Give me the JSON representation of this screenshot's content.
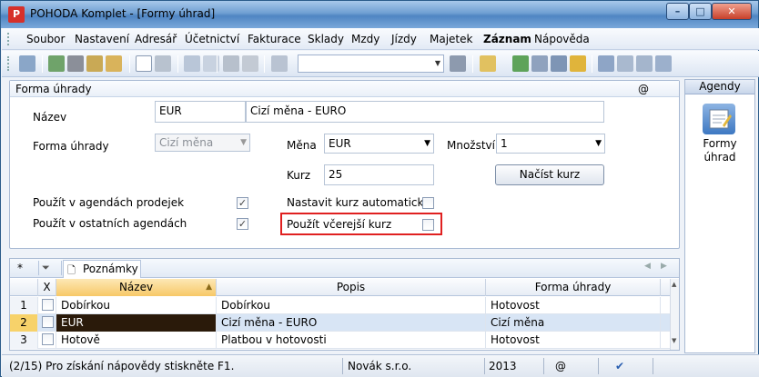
{
  "window": {
    "title": "POHODA Komplet - [Formy úhrad]"
  },
  "menu": [
    "Soubor",
    "Nastavení",
    "Adresář",
    "Účetnictví",
    "Fakturace",
    "Sklady",
    "Mzdy",
    "Jízdy",
    "Majetek",
    "Záznam",
    "Nápověda"
  ],
  "form": {
    "section_title": "Forma úhrady",
    "at_symbol": "@",
    "nazev_label": "Název",
    "nazev_code": "EUR",
    "nazev_name": "Cizí měna - EURO",
    "forma_label": "Forma úhrady",
    "forma_value": "Cizí měna",
    "mena_label": "Měna",
    "mena_value": "EUR",
    "mnozstvi_label": "Množství",
    "mnozstvi_value": "1",
    "kurz_label": "Kurz",
    "kurz_value": "25",
    "nacist_button": "Načíst kurz",
    "prodejek_label": "Použít v agendách prodejek",
    "prodejek_checked": true,
    "ostatnich_label": "Použít v ostatních agendách",
    "ostatnich_checked": true,
    "auto_label": "Nastavit kurz automaticky",
    "auto_checked": false,
    "vcerejsi_label": "Použít včerejší kurz",
    "vcerejsi_checked": false
  },
  "agendy": {
    "header": "Agendy",
    "label": "Formy úhrad"
  },
  "grid": {
    "tab_star": "*",
    "tab_label": "Poznámky",
    "columns": {
      "x": "X",
      "nazev": "Název",
      "popis": "Popis",
      "forma": "Forma úhrady"
    },
    "rows": [
      {
        "num": "1",
        "nazev": "Dobírkou",
        "popis": "Dobírkou",
        "forma": "Hotovost"
      },
      {
        "num": "2",
        "nazev": "EUR",
        "popis": "Cizí měna - EURO",
        "forma": "Cizí měna"
      },
      {
        "num": "3",
        "nazev": "Hotově",
        "popis": "Platbou v hotovosti",
        "forma": "Hotovost"
      }
    ]
  },
  "status": {
    "help": "(2/15) Pro získání nápovědy stiskněte F1.",
    "company": "Novák s.r.o.",
    "year": "2013",
    "at": "@"
  }
}
